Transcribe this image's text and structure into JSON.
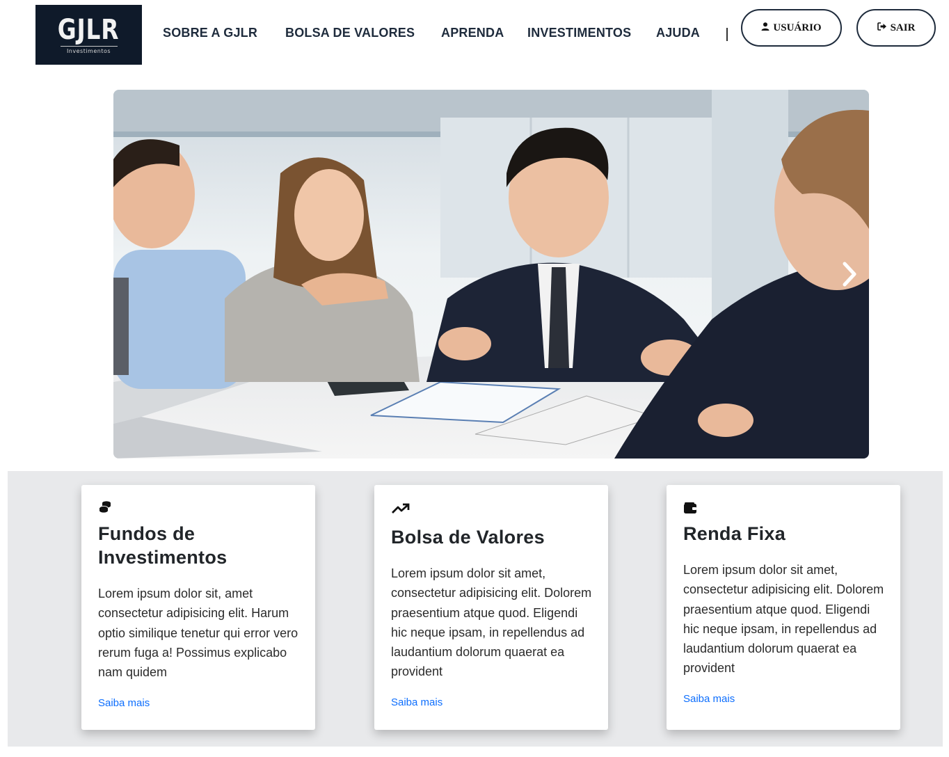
{
  "header": {
    "logo": {
      "main": "GJLR",
      "sub": "Investimentos"
    },
    "nav": [
      {
        "label": "SOBRE A GJLR"
      },
      {
        "label": "BOLSA DE VALORES"
      },
      {
        "label": "APRENDA"
      },
      {
        "label": "INVESTIMENTOS"
      },
      {
        "label": "AJUDA"
      }
    ],
    "user_button": {
      "label": "USUÁRIO",
      "icon": "user-icon"
    },
    "logout_button": {
      "label": "SAIR",
      "icon": "sign-out-icon"
    }
  },
  "hero": {
    "image": "business-meeting-photo",
    "next_icon": "chevron-right-icon"
  },
  "cards": [
    {
      "icon": "coins-icon",
      "title": "Fundos de Investimentos",
      "text": "Lorem ipsum dolor sit, amet consectetur adipisicing elit. Harum optio similique tenetur qui error vero rerum fuga a! Possimus explicabo nam quidem",
      "link": "Saiba mais"
    },
    {
      "icon": "trending-up-icon",
      "title": "Bolsa de Valores",
      "text": "Lorem ipsum dolor sit amet, consectetur adipisicing elit. Dolorem praesentium atque quod. Eligendi hic neque ipsam, in repellendus ad laudantium dolorum quaerat ea provident",
      "link": "Saiba mais"
    },
    {
      "icon": "wallet-icon",
      "title": "Renda Fixa",
      "text": "Lorem ipsum dolor sit amet, consectetur adipisicing elit. Dolorem praesentium atque quod. Eligendi hic neque ipsam, in repellendus ad laudantium dolorum quaerat ea provident",
      "link": "Saiba mais"
    }
  ],
  "colors": {
    "navy": "#0f1a2a",
    "nav_text": "#1e2b3c",
    "link_blue": "#0d6efd",
    "band_gray": "#e8e9eb"
  }
}
